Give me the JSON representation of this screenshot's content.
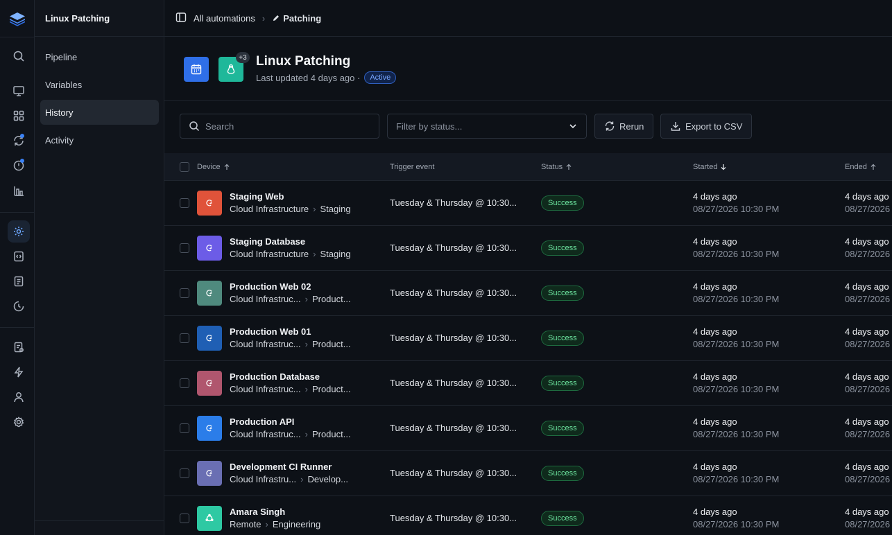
{
  "app": {
    "section_title": "Linux Patching"
  },
  "rail": {
    "icons": [
      "search-icon",
      "monitor-icon",
      "grid-icon",
      "sync-icon",
      "alert-icon",
      "chart-icon",
      "automation-icon",
      "script-icon",
      "document-icon",
      "history-icon",
      "report-icon",
      "bolt-icon",
      "user-icon",
      "settings-icon"
    ]
  },
  "subnav": {
    "items": [
      {
        "label": "Pipeline"
      },
      {
        "label": "Variables"
      },
      {
        "label": "History"
      },
      {
        "label": "Activity"
      }
    ]
  },
  "breadcrumb": {
    "parent": "All automations",
    "sep": "›",
    "current": "Patching"
  },
  "header": {
    "title": "Linux Patching",
    "subtitle": "Last updated 4 days ago ·",
    "status": "Active",
    "extra_count": "+3"
  },
  "toolbar": {
    "search_placeholder": "Search",
    "filter_placeholder": "Filter by status...",
    "rerun_label": "Rerun",
    "export_label": "Export to CSV"
  },
  "table": {
    "columns": {
      "device": "Device",
      "trigger": "Trigger event",
      "status": "Status",
      "started": "Started",
      "ended": "Ended"
    },
    "rows": [
      {
        "name": "Staging Web",
        "path1": "Cloud Infrastructure",
        "path2": "Staging",
        "color": "#e0533a",
        "trigger": "Tuesday & Thursday @ 10:30...",
        "status": "Success",
        "started_rel": "4 days ago",
        "started_abs": "08/27/2026 10:30 PM",
        "ended_rel": "4 days ago",
        "ended_abs": "08/27/2026"
      },
      {
        "name": "Staging Database",
        "path1": "Cloud Infrastructure",
        "path2": "Staging",
        "color": "#6c5ce7",
        "trigger": "Tuesday & Thursday @ 10:30...",
        "status": "Success",
        "started_rel": "4 days ago",
        "started_abs": "08/27/2026 10:30 PM",
        "ended_rel": "4 days ago",
        "ended_abs": "08/27/2026"
      },
      {
        "name": "Production Web 02",
        "path1": "Cloud Infrastruc...",
        "path2": "Product...",
        "color": "#4f8a7e",
        "trigger": "Tuesday & Thursday @ 10:30...",
        "status": "Success",
        "started_rel": "4 days ago",
        "started_abs": "08/27/2026 10:30 PM",
        "ended_rel": "4 days ago",
        "ended_abs": "08/27/2026"
      },
      {
        "name": "Production Web 01",
        "path1": "Cloud Infrastruc...",
        "path2": "Product...",
        "color": "#1f5fb4",
        "trigger": "Tuesday & Thursday @ 10:30...",
        "status": "Success",
        "started_rel": "4 days ago",
        "started_abs": "08/27/2026 10:30 PM",
        "ended_rel": "4 days ago",
        "ended_abs": "08/27/2026"
      },
      {
        "name": "Production Database",
        "path1": "Cloud Infrastruc...",
        "path2": "Product...",
        "color": "#b0566e",
        "trigger": "Tuesday & Thursday @ 10:30...",
        "status": "Success",
        "started_rel": "4 days ago",
        "started_abs": "08/27/2026 10:30 PM",
        "ended_rel": "4 days ago",
        "ended_abs": "08/27/2026"
      },
      {
        "name": "Production API",
        "path1": "Cloud Infrastruc...",
        "path2": "Product...",
        "color": "#2b7de9",
        "trigger": "Tuesday & Thursday @ 10:30...",
        "status": "Success",
        "started_rel": "4 days ago",
        "started_abs": "08/27/2026 10:30 PM",
        "ended_rel": "4 days ago",
        "ended_abs": "08/27/2026"
      },
      {
        "name": "Development CI Runner",
        "path1": "Cloud Infrastru...",
        "path2": "Develop...",
        "color": "#6a6fb3",
        "trigger": "Tuesday & Thursday @ 10:30...",
        "status": "Success",
        "started_rel": "4 days ago",
        "started_abs": "08/27/2026 10:30 PM",
        "ended_rel": "4 days ago",
        "ended_abs": "08/27/2026"
      },
      {
        "name": "Amara Singh",
        "path1": "Remote",
        "path2": "Engineering",
        "color": "#2ec9a3",
        "trigger": "Tuesday & Thursday @ 10:30...",
        "status": "Success",
        "started_rel": "4 days ago",
        "started_abs": "08/27/2026 10:30 PM",
        "ended_rel": "4 days ago",
        "ended_abs": "08/27/2026"
      }
    ]
  },
  "colors": {
    "accent": "#3b82f6",
    "success": "#6ee7a1",
    "background": "#0d1117"
  }
}
